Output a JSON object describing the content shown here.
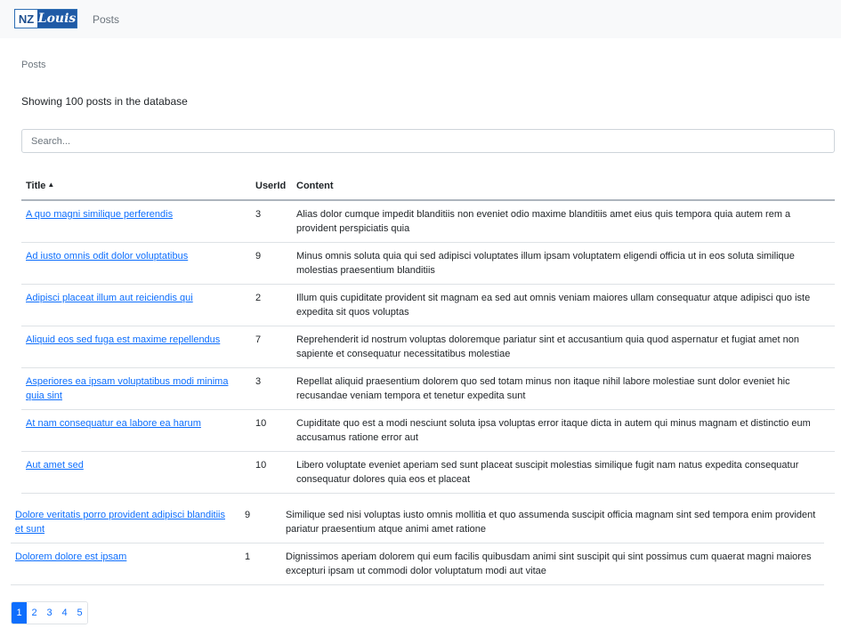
{
  "brand": {
    "nz": "NZ",
    "name": "Louis"
  },
  "nav": {
    "posts": "Posts"
  },
  "breadcrumb": "Posts",
  "summary": "Showing 100 posts in the database",
  "search": {
    "placeholder": "Search...",
    "value": ""
  },
  "table": {
    "headers": {
      "title": "Title",
      "title_sort": "▲",
      "userid": "UserId",
      "content": "Content"
    },
    "rows": [
      {
        "title": "A quo magni similique perferendis",
        "userId": "3",
        "content": "Alias dolor cumque impedit blanditiis non eveniet odio maxime blanditiis amet eius quis tempora quia autem rem a provident perspiciatis quia"
      },
      {
        "title": "Ad iusto omnis odit dolor voluptatibus",
        "userId": "9",
        "content": "Minus omnis soluta quia qui sed adipisci voluptates illum ipsam voluptatem eligendi officia ut in eos soluta similique molestias praesentium blanditiis"
      },
      {
        "title": "Adipisci placeat illum aut reiciendis qui",
        "userId": "2",
        "content": "Illum quis cupiditate provident sit magnam ea sed aut omnis veniam maiores ullam consequatur atque adipisci quo iste expedita sit quos voluptas"
      },
      {
        "title": "Aliquid eos sed fuga est maxime repellendus",
        "userId": "7",
        "content": "Reprehenderit id nostrum voluptas doloremque pariatur sint et accusantium quia quod aspernatur et fugiat amet non sapiente et consequatur necessitatibus molestiae"
      },
      {
        "title": "Asperiores ea ipsam voluptatibus modi minima quia sint",
        "userId": "3",
        "content": "Repellat aliquid praesentium dolorem quo sed totam minus non itaque nihil labore molestiae sunt dolor eveniet hic recusandae veniam tempora et tenetur expedita sunt"
      },
      {
        "title": "At nam consequatur ea labore ea harum",
        "userId": "10",
        "content": "Cupiditate quo est a modi nesciunt soluta ipsa voluptas error itaque dicta in autem qui minus magnam et distinctio eum accusamus ratione error aut"
      },
      {
        "title": "Aut amet sed",
        "userId": "10",
        "content": "Libero voluptate eveniet aperiam sed sunt placeat suscipit molestias similique fugit nam natus expedita consequatur consequatur dolores quia eos et placeat"
      }
    ],
    "rows_shifted": [
      {
        "title": "Dolore veritatis porro provident adipisci blanditiis et sunt",
        "userId": "9",
        "content": "Similique sed nisi voluptas iusto omnis mollitia et quo assumenda suscipit officia magnam sint sed tempora enim provident pariatur praesentium atque animi amet ratione"
      },
      {
        "title": "Dolorem dolore est ipsam",
        "userId": "1",
        "content": "Dignissimos aperiam dolorem qui eum facilis quibusdam animi sint suscipit qui sint possimus cum quaerat magni maiores excepturi ipsam ut commodi dolor voluptatum modi aut vitae"
      }
    ]
  },
  "pagination": {
    "pages": [
      "1",
      "2",
      "3",
      "4",
      "5"
    ],
    "active": "1"
  },
  "colors": {
    "link": "#0d6efd",
    "active_page": "#0d6efd",
    "navbar_bg": "#f8f9fa"
  }
}
